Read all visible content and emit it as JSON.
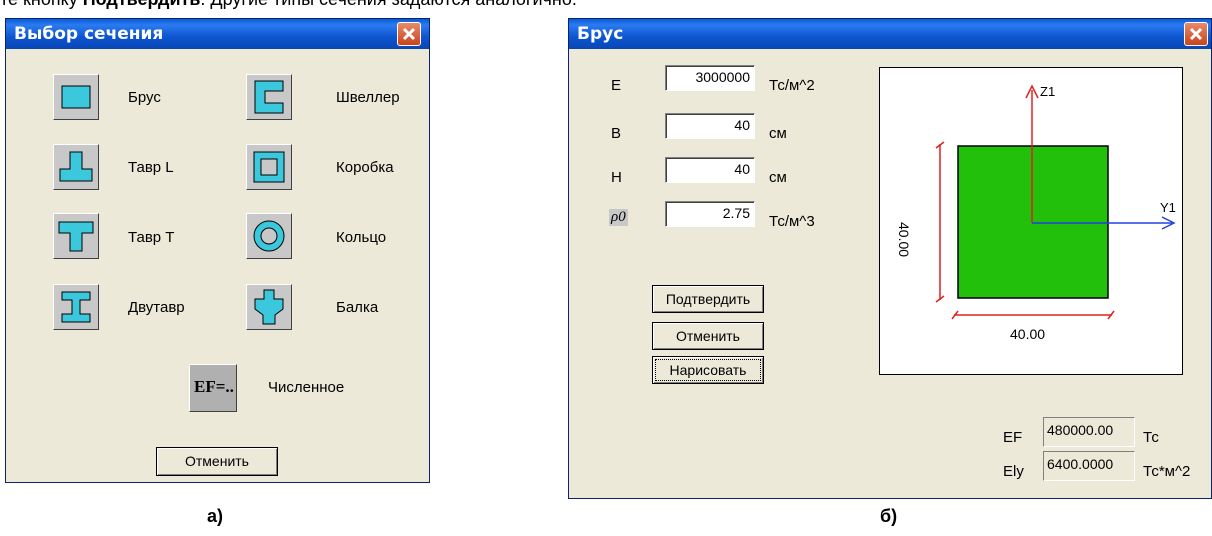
{
  "top_text": {
    "prefix": "те кнопку ",
    "bold": "Подтвердить",
    "suffix": ". Другие типы сечения задаются аналогично."
  },
  "dialog_a": {
    "title": "Выбор сечения",
    "items": [
      {
        "label": "Брус",
        "icon": "rect-section-icon"
      },
      {
        "label": "Швеллер",
        "icon": "channel-section-icon"
      },
      {
        "label": "Тавр L",
        "icon": "tee-l-section-icon"
      },
      {
        "label": "Коробка",
        "icon": "box-section-icon"
      },
      {
        "label": "Тавр Т",
        "icon": "tee-t-section-icon"
      },
      {
        "label": "Кольцо",
        "icon": "ring-section-icon"
      },
      {
        "label": "Двутавр",
        "icon": "i-beam-section-icon"
      },
      {
        "label": "Балка",
        "icon": "beam-section-icon"
      }
    ],
    "numeric": {
      "label": "Численное",
      "icon_text": "EF=.."
    },
    "cancel": "Отменить"
  },
  "dialog_b": {
    "title": "Брус",
    "params": [
      {
        "name": "E",
        "value": "3000000",
        "unit": "Тс/м^2"
      },
      {
        "name": "B",
        "value": "40",
        "unit": "см"
      },
      {
        "name": "H",
        "value": "40",
        "unit": "см"
      },
      {
        "name": "ρ0",
        "value": "2.75",
        "unit": "Тс/м^3"
      }
    ],
    "buttons": {
      "confirm": "Подтвердить",
      "cancel": "Отменить",
      "draw": "Нарисовать"
    },
    "preview": {
      "z_axis": "Z1",
      "y_axis": "Y1",
      "width_dim": "40.00",
      "height_dim": "40.00",
      "fill": "#22c00a"
    },
    "results": [
      {
        "name": "EF",
        "value": "480000.00",
        "unit": "Тс"
      },
      {
        "name": "Ely",
        "value": "6400.0000",
        "unit": "Тс*м^2"
      }
    ]
  },
  "captions": {
    "a": "а)",
    "b": "б)"
  }
}
